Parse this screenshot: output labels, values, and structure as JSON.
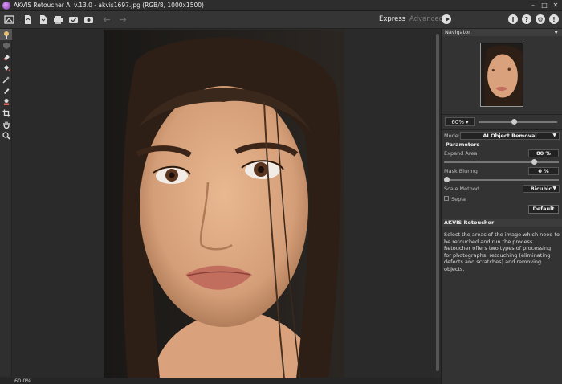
{
  "window": {
    "title": "AKVIS Retoucher AI v.13.0 - akvis1697.jpg (RGB/8, 1000x1500)",
    "controls": [
      "–",
      "□",
      "✕"
    ]
  },
  "toolbar": {
    "modes": {
      "express": "Express",
      "advanced": "Advanced"
    },
    "right_icons": [
      "i",
      "?",
      "⚙",
      "!"
    ]
  },
  "navigator": {
    "title": "Navigator",
    "zoom": "60%",
    "zoom_caret": "▾"
  },
  "settings": {
    "mode_label": "Mode:",
    "mode_value": "AI Object Removal",
    "parameters_title": "Parameters",
    "expand_area_label": "Expand Area",
    "expand_area_value": "80 %",
    "expand_area_level": 80,
    "mask_blurring_label": "Mask Bluring",
    "mask_blurring_value": "0 %",
    "mask_blurring_level": 0,
    "scale_method_label": "Scale Method",
    "scale_method_value": "Bicubic",
    "sepia_label": "Sepia",
    "sepia_checked": false,
    "default_label": "Default"
  },
  "help": {
    "title": "AKVIS Retoucher",
    "text_1": "Select the areas of the image which need to be retouched and run the process.",
    "text_2": "Retoucher offers two types of processing for photographs: retouching (eliminating defects and scratches) and removing objects."
  },
  "status": {
    "zoom": "60.0%"
  },
  "colors": {
    "panel_bg": "#333333",
    "canvas_bg": "#2a2a2a",
    "accent": "#7a2fa0"
  }
}
